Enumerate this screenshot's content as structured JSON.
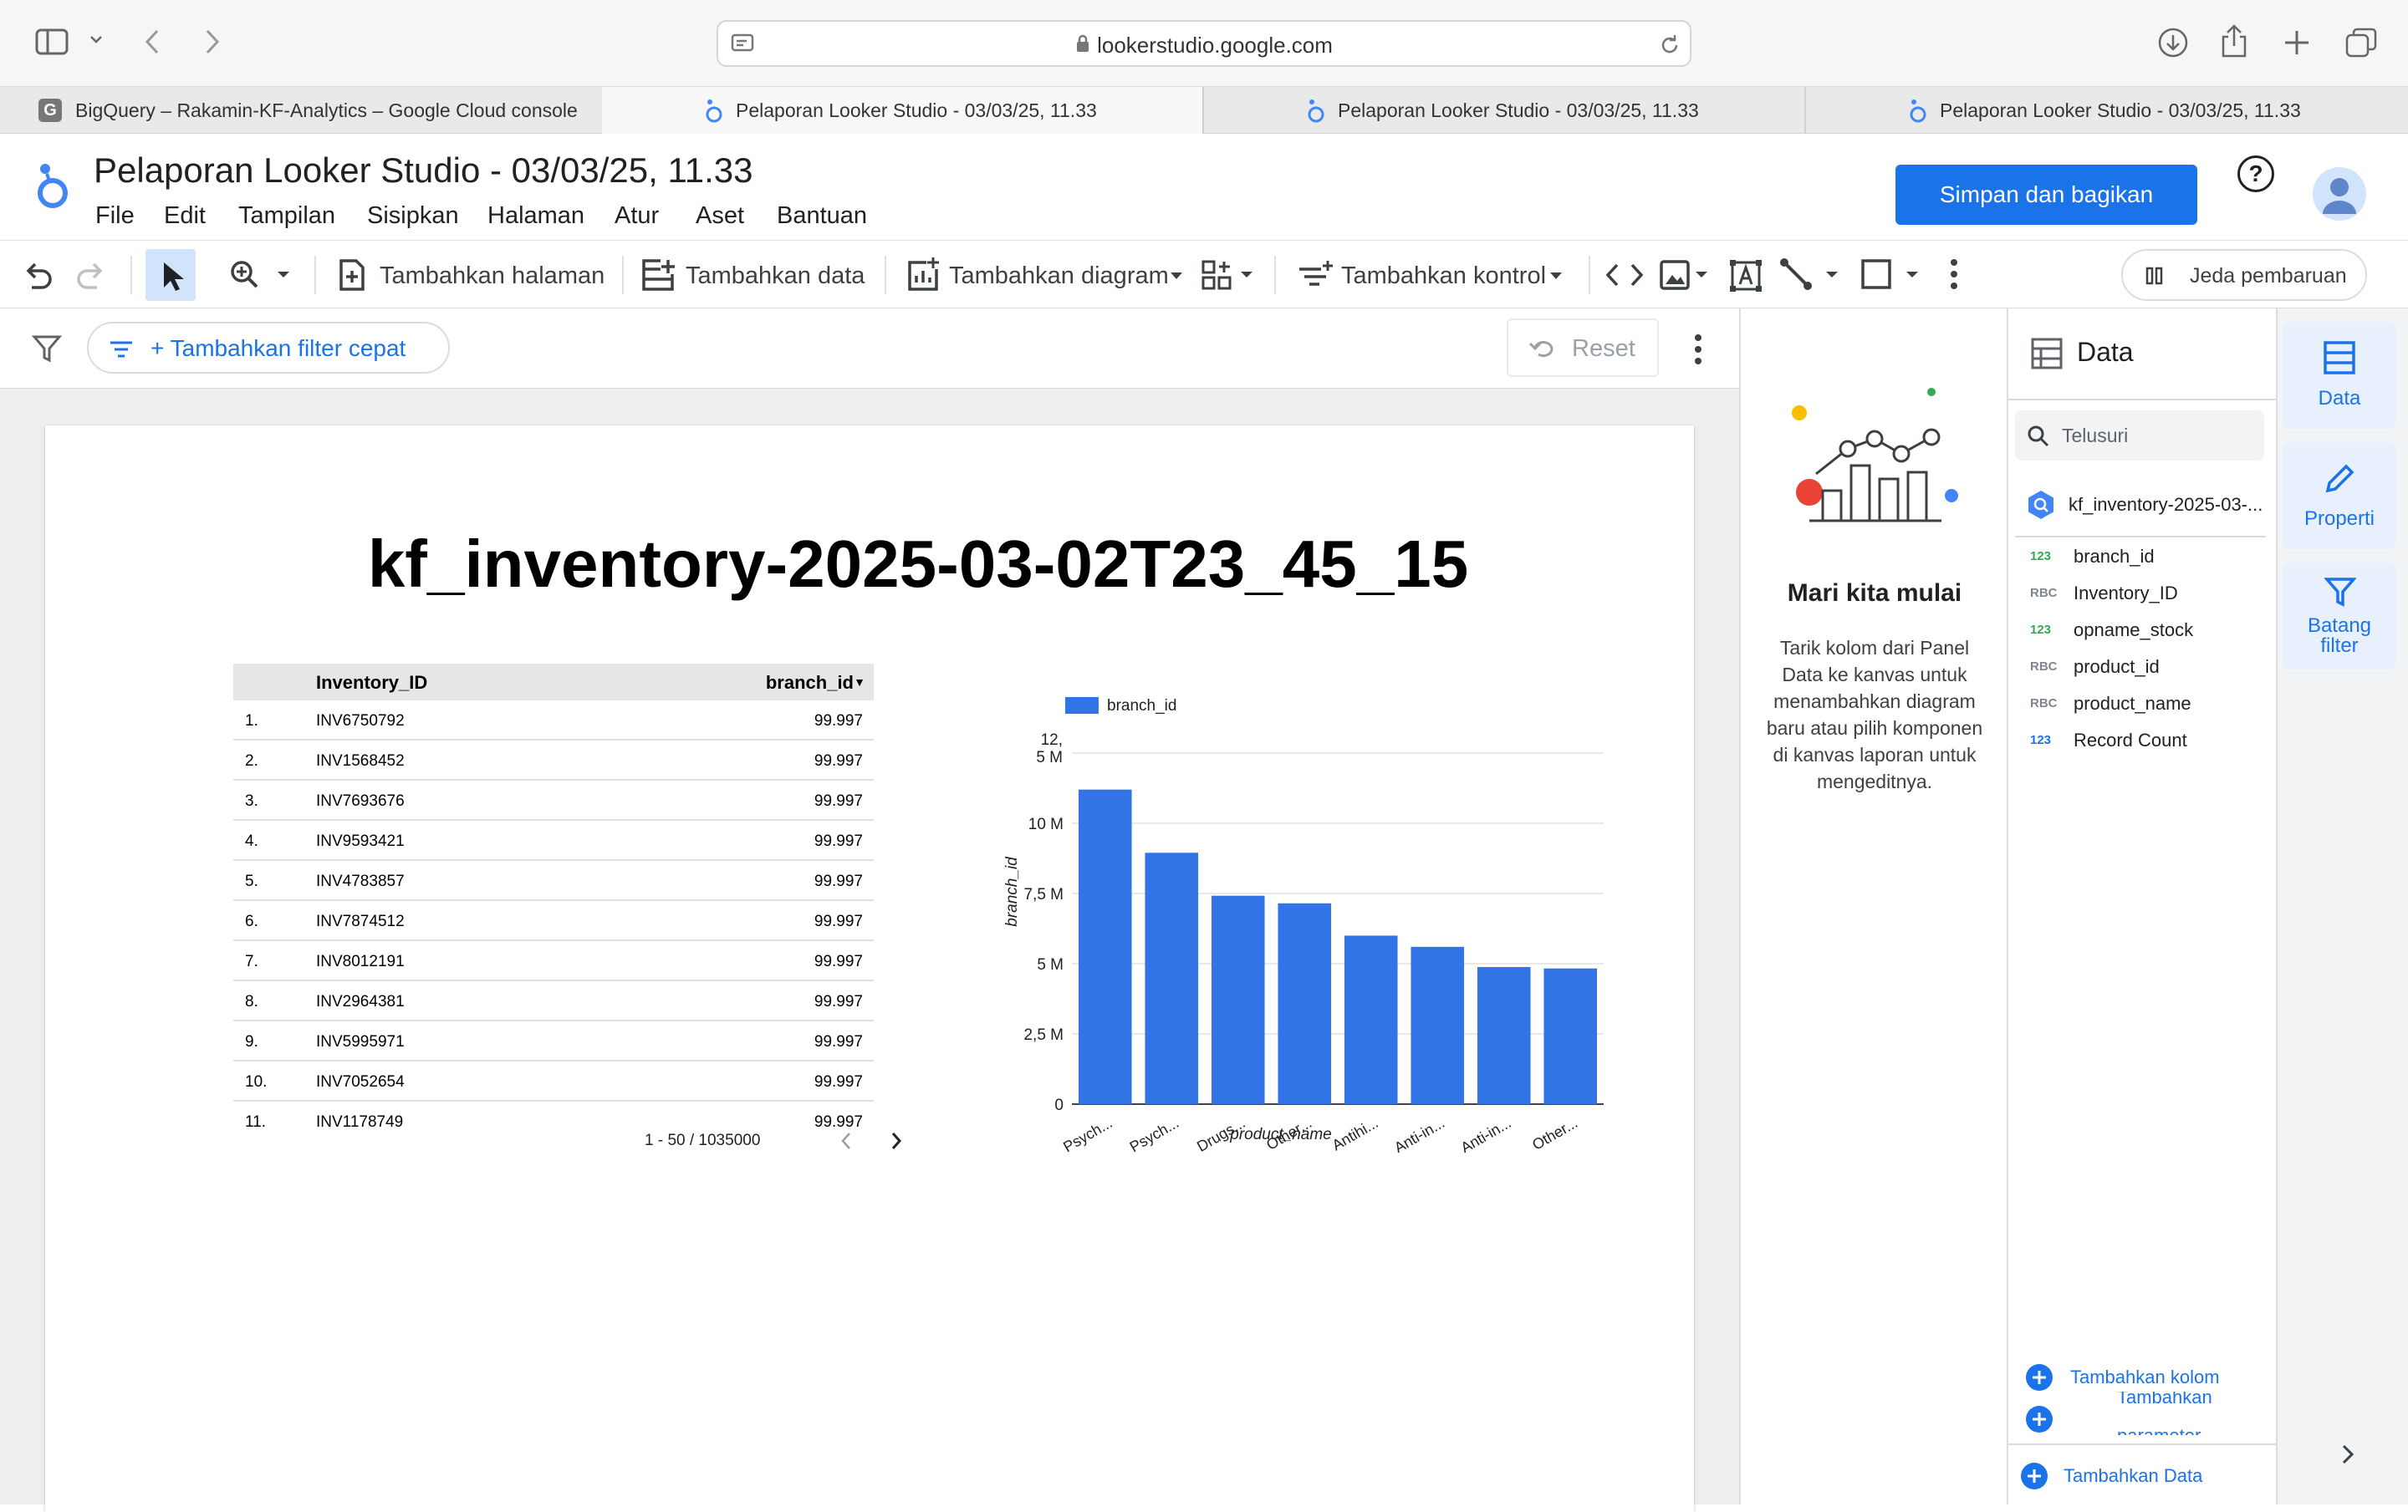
{
  "browser": {
    "url": "lookerstudio.google.com",
    "tabs": [
      {
        "label": "BigQuery – Rakamin-KF-Analytics – Google Cloud console",
        "favicon": "G"
      },
      {
        "label": "Pelaporan Looker Studio - 03/03/25, 11.33"
      },
      {
        "label": "Pelaporan Looker Studio - 03/03/25, 11.33"
      },
      {
        "label": "Pelaporan Looker Studio - 03/03/25, 11.33"
      }
    ]
  },
  "header": {
    "title": "Pelaporan Looker Studio - 03/03/25, 11.33",
    "menu": [
      "File",
      "Edit",
      "Tampilan",
      "Sisipkan",
      "Halaman",
      "Atur",
      "Aset",
      "Bantuan"
    ],
    "share_label": "Simpan dan bagikan",
    "help_icon": "?"
  },
  "toolbar": {
    "add_page": "Tambahkan halaman",
    "add_data": "Tambahkan data",
    "add_chart": "Tambahkan diagram",
    "add_control": "Tambahkan kontrol",
    "pause": "Jeda pembaruan"
  },
  "filterbar": {
    "quick_filter": "+ Tambahkan filter cepat",
    "reset": "Reset"
  },
  "report": {
    "title": "kf_inventory-2025-03-02T23_45_15",
    "table": {
      "headers": [
        "Inventory_ID",
        "branch_id"
      ],
      "sort_icon": "▼",
      "rows": [
        {
          "n": "1.",
          "id": "INV6750792",
          "val": "99.997"
        },
        {
          "n": "2.",
          "id": "INV1568452",
          "val": "99.997"
        },
        {
          "n": "3.",
          "id": "INV7693676",
          "val": "99.997"
        },
        {
          "n": "4.",
          "id": "INV9593421",
          "val": "99.997"
        },
        {
          "n": "5.",
          "id": "INV4783857",
          "val": "99.997"
        },
        {
          "n": "6.",
          "id": "INV7874512",
          "val": "99.997"
        },
        {
          "n": "7.",
          "id": "INV8012191",
          "val": "99.997"
        },
        {
          "n": "8.",
          "id": "INV2964381",
          "val": "99.997"
        },
        {
          "n": "9.",
          "id": "INV5995971",
          "val": "99.997"
        },
        {
          "n": "10.",
          "id": "INV7052654",
          "val": "99.997"
        },
        {
          "n": "11.",
          "id": "INV1178749",
          "val": "99.997"
        }
      ],
      "pagination": "1 - 50 / 1035000"
    }
  },
  "chart_data": {
    "type": "bar",
    "categories": [
      "Psych...",
      "Psych...",
      "Drugs...",
      "Other...",
      "Antihi...",
      "Anti-in...",
      "Anti-in...",
      "Other..."
    ],
    "series": [
      {
        "name": "branch_id",
        "values": [
          11200000,
          8950000,
          7420000,
          7150000,
          6000000,
          5600000,
          4880000,
          4830000
        ]
      }
    ],
    "xlabel": "product_name",
    "ylabel": "branch_id",
    "yticks": [
      "0",
      "2,5 M",
      "5 M",
      "7,5 M",
      "10 M"
    ],
    "ytop_tick": [
      "12,",
      "5 M"
    ],
    "ylim": [
      0,
      12500000
    ],
    "legend": "top-left",
    "grid": true,
    "color": "#3273e6"
  },
  "empty_panel": {
    "title": "Mari kita mulai",
    "body": "Tarik kolom dari Panel Data ke kanvas untuk menambahkan diagram baru atau pilih komponen di kanvas laporan untuk mengeditnya."
  },
  "data_panel": {
    "title": "Data",
    "search_placeholder": "Telusuri",
    "source": "kf_inventory-2025-03-...",
    "fields": [
      {
        "type": "123",
        "name": "branch_id"
      },
      {
        "type": "RBC",
        "name": "Inventory_ID"
      },
      {
        "type": "123",
        "name": "opname_stock"
      },
      {
        "type": "RBC",
        "name": "product_id"
      },
      {
        "type": "RBC",
        "name": "product_name"
      },
      {
        "type": "123",
        "name": "Record Count"
      }
    ],
    "add_field": "Tambahkan kolom",
    "add_param_1": "Tambahkan",
    "add_param_2": "parameter",
    "add_data": "Tambahkan Data"
  },
  "rail": {
    "data": "Data",
    "properti": "Properti",
    "filter_1": "Batang",
    "filter_2": "filter"
  }
}
